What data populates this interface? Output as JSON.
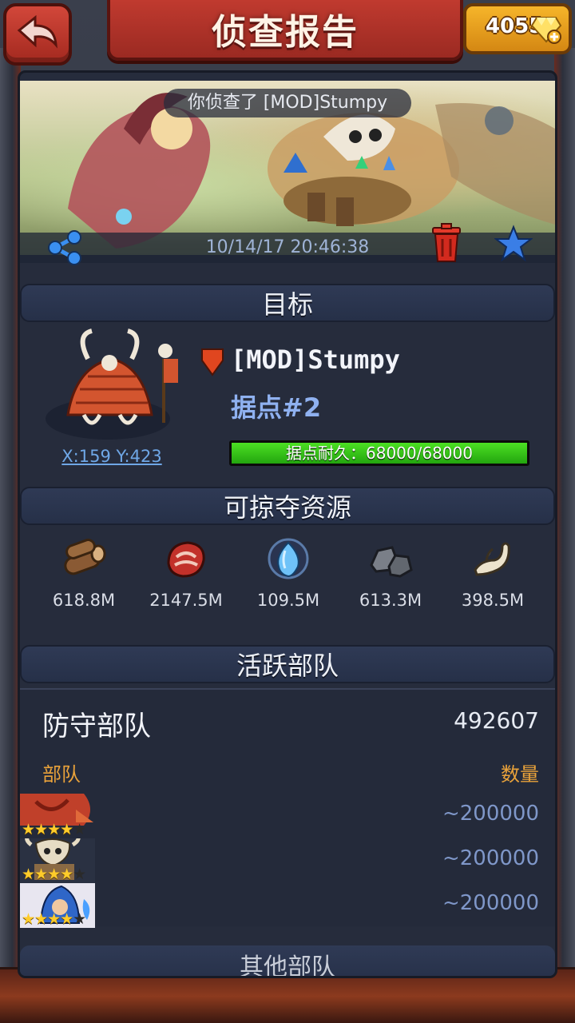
{
  "header": {
    "title": "侦查报告",
    "gems": "4055"
  },
  "report": {
    "scouted_text": "你侦查了 [MOD]Stumpy",
    "timestamp": "10/14/17 20:46:38"
  },
  "target": {
    "section_title": "目标",
    "player_name": "[MOD]Stumpy",
    "stronghold": "据点#2",
    "coordinates": "X:159 Y:423",
    "durability_label": "据点耐久：68000/68000",
    "durability_fraction": 1.0
  },
  "resources": {
    "section_title": "可掠夺资源",
    "items": [
      {
        "icon": "wood-icon",
        "value": "618.8M"
      },
      {
        "icon": "meat-icon",
        "value": "2147.5M"
      },
      {
        "icon": "crystal-icon",
        "value": "109.5M"
      },
      {
        "icon": "stone-icon",
        "value": "613.3M"
      },
      {
        "icon": "bone-icon",
        "value": "398.5M"
      }
    ]
  },
  "troops": {
    "section_title": "活跃部队",
    "defense_title": "防守部队",
    "defense_total": "492607",
    "col_unit": "部队",
    "col_qty": "数量",
    "rows": [
      {
        "icon": "red-beast-portrait",
        "stars": 4,
        "max_stars": 5,
        "qty": "~200000"
      },
      {
        "icon": "skull-warrior-portrait",
        "stars": 4,
        "max_stars": 5,
        "qty": "~200000"
      },
      {
        "icon": "blue-mage-portrait",
        "stars": 4,
        "max_stars": 5,
        "qty": "~200000"
      }
    ]
  },
  "other": {
    "section_title": "其他部队"
  },
  "colors": {
    "accent_red": "#c03a2f",
    "gold": "#f6b52a",
    "durability_green": "#4ce023",
    "link_blue": "#6fa7e6"
  }
}
